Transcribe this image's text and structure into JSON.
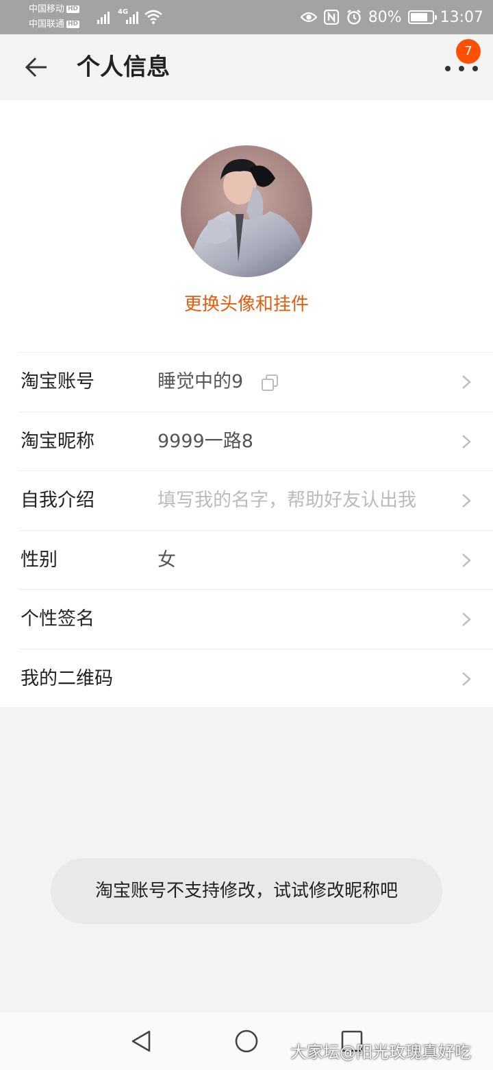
{
  "status_bar": {
    "carrier1": "中国移动",
    "carrier2": "中国联通",
    "hd": "HD",
    "network": "4G",
    "battery": "80%",
    "time": "13:07"
  },
  "header": {
    "title": "个人信息",
    "badge_count": "7"
  },
  "profile": {
    "change_avatar_label": "更换头像和挂件"
  },
  "rows": [
    {
      "label": "淘宝账号",
      "value": "睡觉中的9"
    },
    {
      "label": "淘宝昵称",
      "value": "9999一路8"
    },
    {
      "label": "自我介绍",
      "placeholder": "填写我的名字，帮助好友认出我"
    },
    {
      "label": "性别",
      "value": "女"
    },
    {
      "label": "个性签名",
      "value": ""
    },
    {
      "label": "我的二维码",
      "value": ""
    }
  ],
  "toast": {
    "message": "淘宝账号不支持修改，试试修改昵称吧"
  },
  "watermark": "大家坛@阳光玫瑰真好吃",
  "colors": {
    "accent": "#e85a0c",
    "badge": "#ff4f00",
    "status_bar": "#a3a3a3"
  }
}
